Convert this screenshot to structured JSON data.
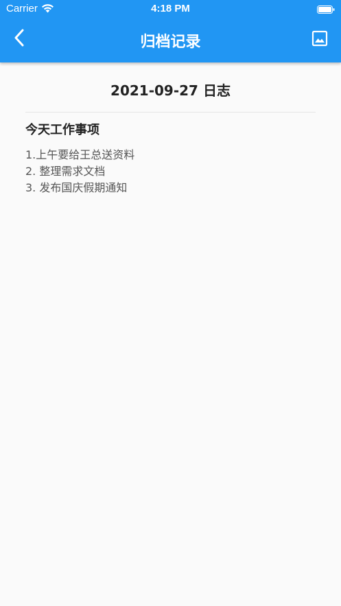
{
  "status_bar": {
    "carrier": "Carrier",
    "time": "4:18 PM",
    "wifi_icon": "wifi-icon",
    "battery_icon": "battery-full-icon"
  },
  "app_bar": {
    "title": "归档记录",
    "background_color": "#2196f3",
    "back_icon": "chevron-left-icon",
    "action_icon": "image-icon"
  },
  "log": {
    "title": "2021-09-27 日志",
    "section_title": "今天工作事项",
    "items": [
      "1.上午要给王总送资料",
      "2. 整理需求文档",
      "3. 发布国庆假期通知"
    ]
  }
}
